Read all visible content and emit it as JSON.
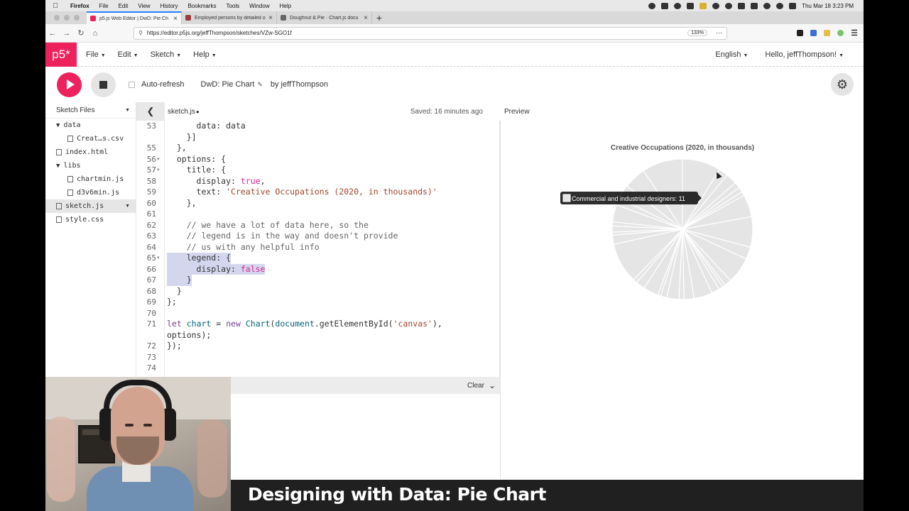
{
  "menubar": {
    "app": "Firefox",
    "items": [
      "File",
      "Edit",
      "View",
      "History",
      "Bookmarks",
      "Tools",
      "Window",
      "Help"
    ],
    "clock": "Thu Mar 18  3:23 PM"
  },
  "browser": {
    "tabs": [
      {
        "title": "p5.js Web Editor | DwD: Pie Ch",
        "active": true,
        "favicon_color": "#ed225d"
      },
      {
        "title": "Employed persons by detailed o",
        "active": false,
        "favicon_color": "#9a3b3b"
      },
      {
        "title": "Doughnut & Pie · Chart.js docu",
        "active": false,
        "favicon_color": "#666666"
      }
    ],
    "url": "https://editor.p5js.org/jeffThompson/sketches/VZw-SGO1f",
    "zoom": "133%"
  },
  "p5": {
    "logo": "p5*",
    "menus": [
      "File",
      "Edit",
      "Sketch",
      "Help"
    ],
    "language": "English",
    "greeting": "Hello, jeffThompson!"
  },
  "toolbar": {
    "auto_refresh": "Auto-refresh",
    "sketch_name": "DwD: Pie Chart",
    "byline": "by jeffThompson"
  },
  "sidebar": {
    "title": "Sketch Files",
    "items": [
      {
        "label": "data",
        "type": "folder",
        "depth": 0
      },
      {
        "label": "Creat…s.csv",
        "type": "file",
        "depth": 1
      },
      {
        "label": "index.html",
        "type": "file",
        "depth": 0
      },
      {
        "label": "libs",
        "type": "folder",
        "depth": 0
      },
      {
        "label": "chartmin.js",
        "type": "file",
        "depth": 1
      },
      {
        "label": "d3v6min.js",
        "type": "file",
        "depth": 1
      },
      {
        "label": "sketch.js",
        "type": "file",
        "depth": 0,
        "selected": true
      },
      {
        "label": "style.css",
        "type": "file",
        "depth": 0
      }
    ]
  },
  "editor": {
    "filename": "sketch.js",
    "unsaved_marker": "●",
    "saved_status": "Saved: 16 minutes ago",
    "lines": [
      {
        "n": "53",
        "text": "      data: data",
        "fold": false
      },
      {
        "n": "",
        "text": "    }]",
        "fold": false
      },
      {
        "n": "55",
        "text": "  },",
        "fold": false
      },
      {
        "n": "56",
        "text": "  options: {",
        "fold": true
      },
      {
        "n": "57",
        "text": "    title: {",
        "fold": true
      },
      {
        "n": "58",
        "text": "      display: true,",
        "fold": false
      },
      {
        "n": "59",
        "text": "      text: 'Creative Occupations (2020, in thousands)'",
        "fold": false
      },
      {
        "n": "60",
        "text": "    },",
        "fold": false
      },
      {
        "n": "61",
        "text": "",
        "fold": false
      },
      {
        "n": "62",
        "text": "    // we have a lot of data here, so the",
        "fold": false
      },
      {
        "n": "63",
        "text": "    // legend is in the way and doesn't provide",
        "fold": false
      },
      {
        "n": "64",
        "text": "    // us with any helpful info",
        "fold": false
      },
      {
        "n": "65",
        "text": "    legend: {",
        "fold": true
      },
      {
        "n": "66",
        "text": "      display: false",
        "fold": false
      },
      {
        "n": "67",
        "text": "    }",
        "fold": false
      },
      {
        "n": "68",
        "text": "  }",
        "fold": false
      },
      {
        "n": "69",
        "text": "};",
        "fold": false
      },
      {
        "n": "70",
        "text": "",
        "fold": false
      },
      {
        "n": "71",
        "text": "let chart = new Chart(document.getElementById('canvas'),",
        "fold": false
      },
      {
        "n": "",
        "text": "options);",
        "fold": false
      },
      {
        "n": "72",
        "text": "});",
        "fold": false
      },
      {
        "n": "73",
        "text": "",
        "fold": false
      },
      {
        "n": "74",
        "text": "",
        "fold": false
      }
    ]
  },
  "console": {
    "clear_label": "Clear"
  },
  "preview": {
    "label": "Preview"
  },
  "chart_data": {
    "type": "pie",
    "title": "Creative Occupations (2020, in thousands)",
    "legend": "hidden",
    "slice_color": "#e5e5e5",
    "border_color": "#ffffff",
    "tooltip": "Commercial and industrial designers: 11",
    "values": [
      38,
      9,
      11,
      6,
      5,
      4,
      22,
      30,
      12,
      26,
      7,
      3,
      4,
      8,
      18,
      10,
      5,
      12,
      6,
      3,
      15,
      9,
      4,
      40,
      9,
      3,
      6,
      4,
      17,
      7,
      14,
      22,
      40
    ]
  },
  "video": {
    "title": "Designing with Data: Pie Chart"
  }
}
